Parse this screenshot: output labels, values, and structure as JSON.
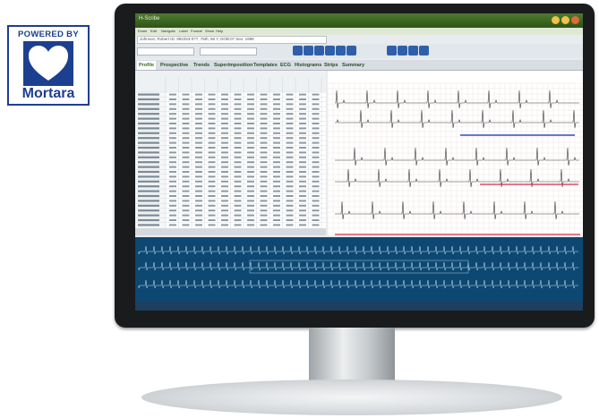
{
  "logo": {
    "line1": "POWERED BY",
    "line2": "Mortara"
  },
  "app": {
    "title": "H-Scribe",
    "menu": [
      "Exam",
      "Edit",
      "Navigate",
      "Label",
      "Format",
      "Show",
      "Help"
    ],
    "patient": "Johnson, Robert  ID: 992253-0??, 75th, 68 Y, DOB:0? Sex: 1996",
    "tabs": [
      "Profile",
      "Prospective",
      "Trends",
      "Superimposition",
      "Templates",
      "ECG",
      "Histograms",
      "Strips",
      "Summary"
    ],
    "active_tab": 0
  },
  "colors": {
    "title_green": "#3b6a1b",
    "tool_blue": "#2f5fa8",
    "navy_panel": "#0c4872",
    "logo_blue": "#1d3f8f"
  }
}
